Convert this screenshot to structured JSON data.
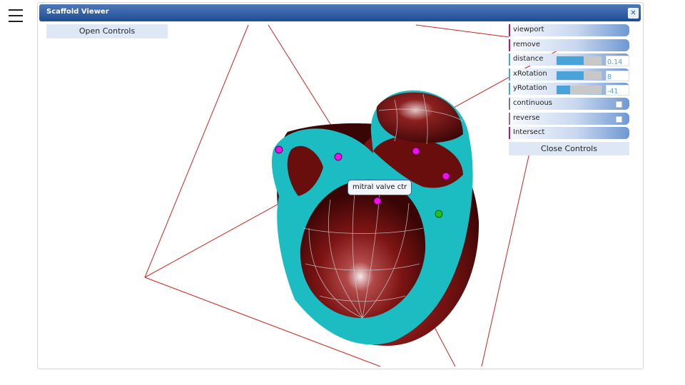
{
  "window": {
    "title": "Scaffold Viewer",
    "close_glyph": "✕"
  },
  "controls": {
    "open_label": "Open Controls",
    "close_label": "Close Controls",
    "items": [
      {
        "label": "viewport",
        "type": "folder"
      },
      {
        "label": "remove",
        "type": "folder"
      },
      {
        "label": "distance",
        "type": "number",
        "value": "0.14",
        "fill": 0.6
      },
      {
        "label": "xRotation",
        "type": "number",
        "value": "8",
        "fill": 0.6
      },
      {
        "label": "yRotation",
        "type": "number",
        "value": "-41",
        "fill": 0.3
      },
      {
        "label": "continuous",
        "type": "boolean",
        "checked": false
      },
      {
        "label": "reverse",
        "type": "boolean",
        "checked": false
      },
      {
        "label": "Intersect",
        "type": "folder"
      }
    ]
  },
  "tooltip": {
    "label": "mitral valve ctr"
  },
  "colors": {
    "surface": "#6a0d0d",
    "cut": "#1bbcc2",
    "marker": "#ee11ee",
    "marker_alt": "#1ec21e",
    "plane": "#d52020"
  },
  "icons": {
    "menu": "hamburger-menu-icon"
  }
}
